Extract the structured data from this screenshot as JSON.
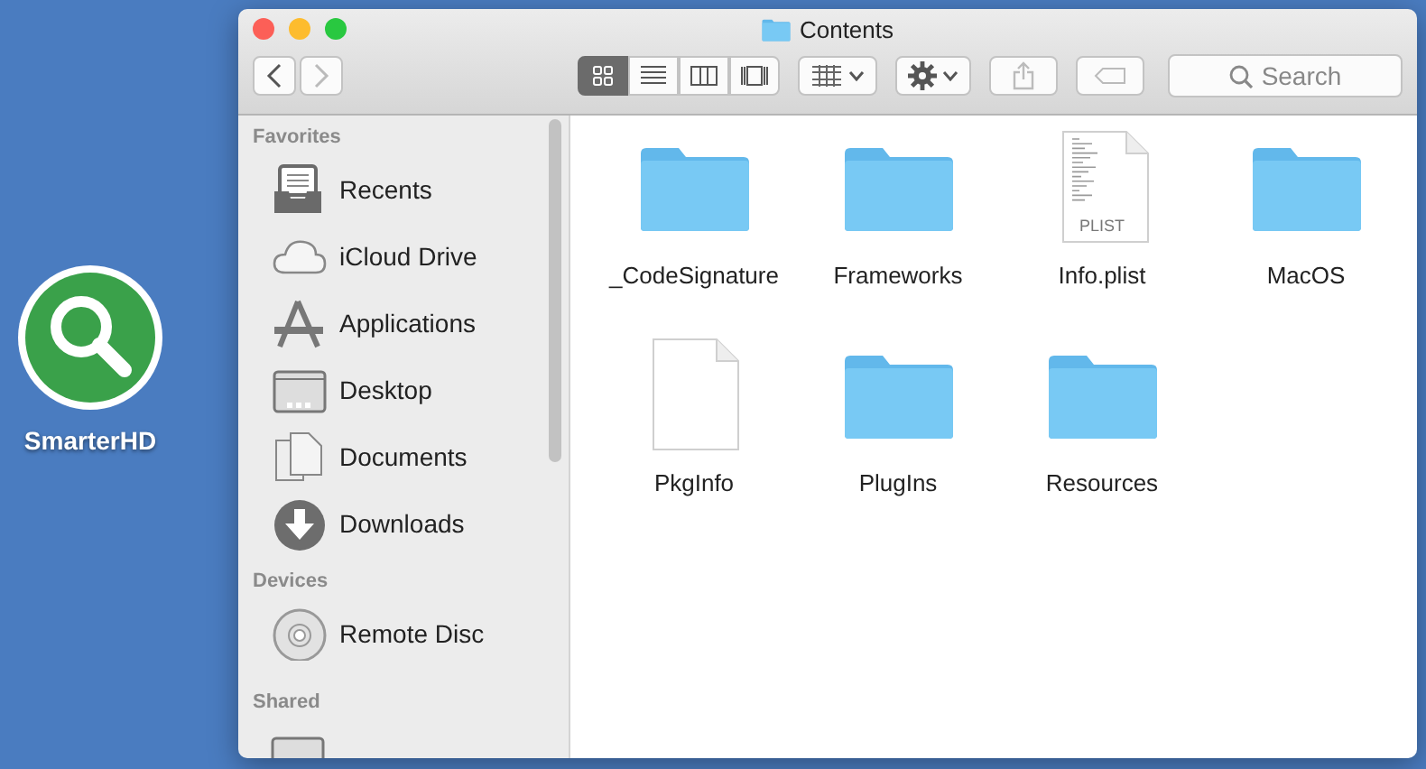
{
  "desktop_icon": {
    "label": "SmarterHD"
  },
  "window": {
    "title": "Contents"
  },
  "toolbar": {
    "view_modes": [
      {
        "kind": "icons",
        "selected": true
      },
      {
        "kind": "list",
        "selected": false
      },
      {
        "kind": "columns",
        "selected": false
      },
      {
        "kind": "gallery",
        "selected": false
      }
    ],
    "search": {
      "placeholder": "Search"
    }
  },
  "sidebar": {
    "sections": [
      {
        "heading": "Favorites",
        "items": [
          {
            "label": "Recents",
            "kind": "recents"
          },
          {
            "label": "iCloud Drive",
            "kind": "cloud"
          },
          {
            "label": "Applications",
            "kind": "applications"
          },
          {
            "label": "Desktop",
            "kind": "desktop"
          },
          {
            "label": "Documents",
            "kind": "documents"
          },
          {
            "label": "Downloads",
            "kind": "downloads"
          }
        ]
      },
      {
        "heading": "Devices",
        "items": [
          {
            "label": "Remote Disc",
            "kind": "disc"
          }
        ]
      },
      {
        "heading": "Shared"
      }
    ]
  },
  "files": [
    {
      "name": "_CodeSignature",
      "kind": "folder"
    },
    {
      "name": "Frameworks",
      "kind": "folder"
    },
    {
      "name": "Info.plist",
      "kind": "plist",
      "badge": "PLIST"
    },
    {
      "name": "MacOS",
      "kind": "folder"
    },
    {
      "name": "PkgInfo",
      "kind": "document"
    },
    {
      "name": "PlugIns",
      "kind": "folder"
    },
    {
      "name": "Resources",
      "kind": "folder"
    }
  ]
}
